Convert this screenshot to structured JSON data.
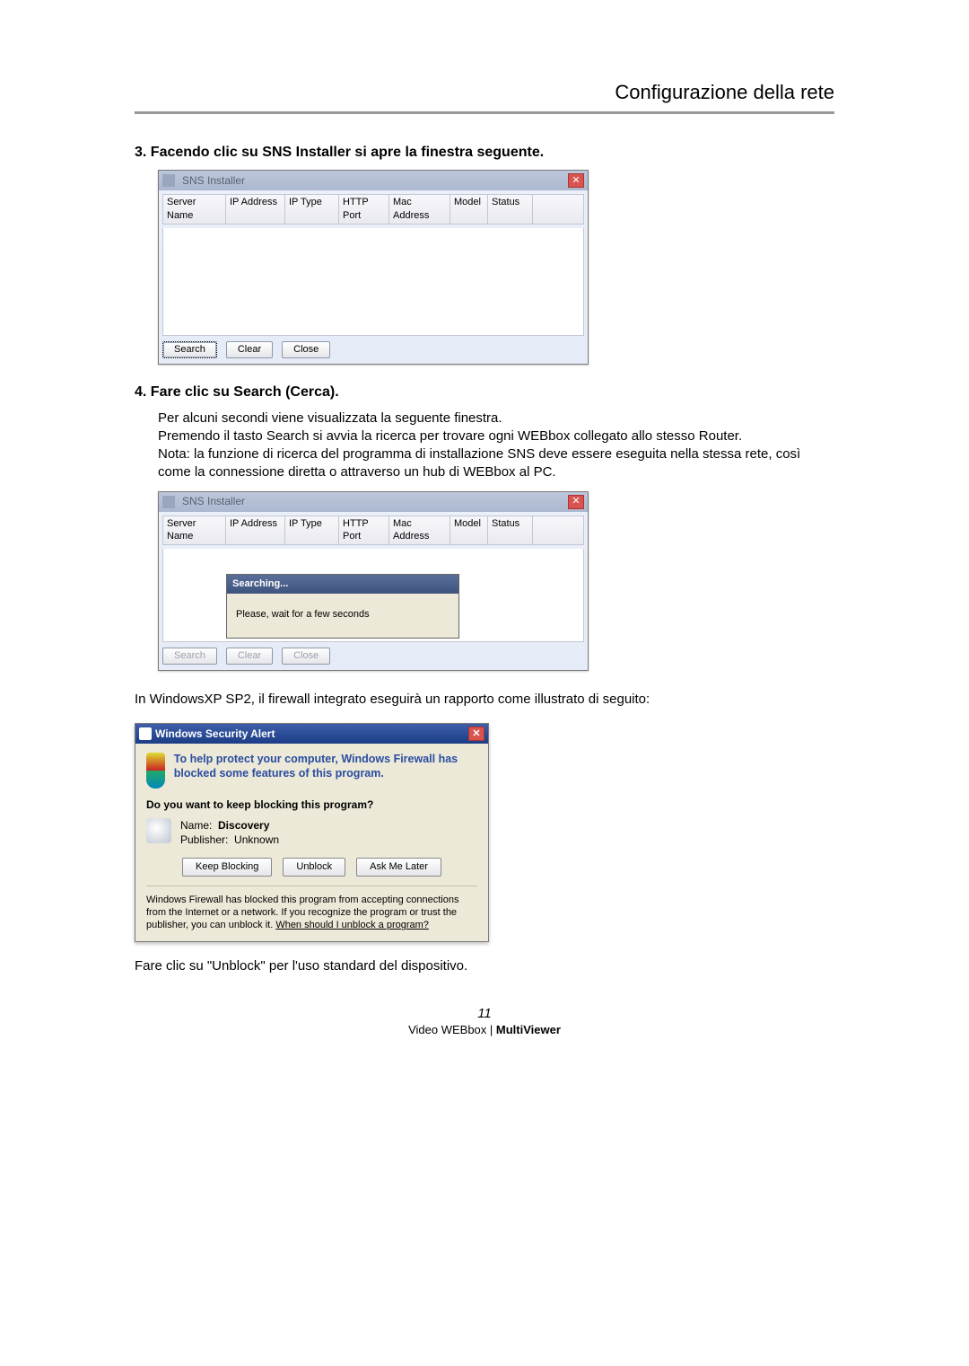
{
  "header": {
    "title": "Configurazione della rete"
  },
  "step3": {
    "heading": "3. Facendo clic su SNS Installer si apre la finestra seguente."
  },
  "step4": {
    "heading": "4. Fare clic su Search (Cerca).",
    "line1": "Per alcuni secondi viene visualizzata la seguente finestra.",
    "line2": "Premendo il tasto Search si avvia la ricerca per trovare ogni WEBbox collegato allo stesso Router.",
    "line3": "Nota: la funzione di ricerca del programma di installazione SNS deve essere eseguita nella stessa rete, così come la connessione diretta o attraverso un hub di WEBbox al PC."
  },
  "snsWindow": {
    "title": "SNS Installer",
    "columns": [
      "Server Name",
      "IP Address",
      "IP Type",
      "HTTP Port",
      "Mac Address",
      "Model",
      "Status"
    ],
    "buttons": {
      "search": "Search",
      "clear": "Clear",
      "close": "Close"
    },
    "searching": {
      "title": "Searching...",
      "body": "Please, wait for a few seconds"
    }
  },
  "firewall": {
    "intro": "In WindowsXP SP2, il firewall integrato eseguirà un rapporto come illustrato di seguito:",
    "title": "Windows Security Alert",
    "headline": "To help protect your computer, Windows Firewall has blocked some features of this program.",
    "question": "Do you want to keep blocking this program?",
    "nameLabel": "Name:",
    "nameValue": "Discovery",
    "pubLabel": "Publisher:",
    "pubValue": "Unknown",
    "buttons": {
      "keep": "Keep Blocking",
      "unblock": "Unblock",
      "later": "Ask Me Later"
    },
    "fineprint1": "Windows Firewall has blocked this program from accepting connections from the Internet or a network. If you recognize the program or trust the publisher, you can unblock it. ",
    "finelink": "When should I unblock a program?",
    "after": "Fare clic su \"Unblock\" per l'uso standard del dispositivo."
  },
  "footer": {
    "page": "11",
    "productA": "Video WEBbox",
    "sep": " | ",
    "productB": "MultiViewer"
  }
}
